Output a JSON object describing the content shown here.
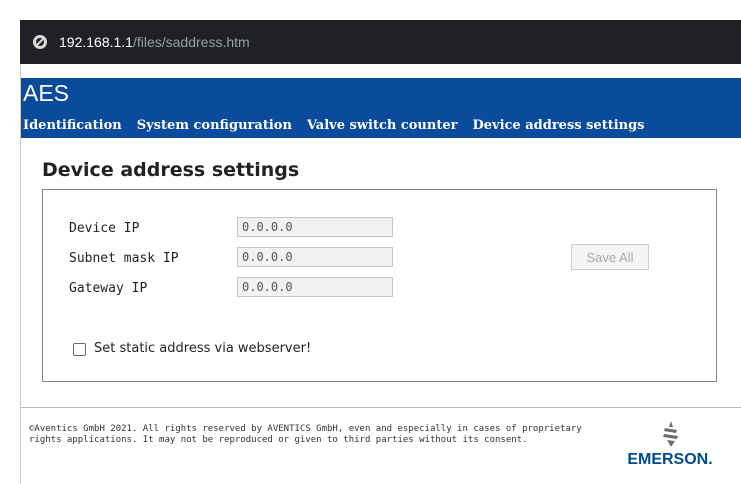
{
  "browser": {
    "url_host": "192.168.1.1",
    "url_path": "/files/saddress.htm"
  },
  "header": {
    "title": "AES",
    "nav": [
      {
        "label": "Identification"
      },
      {
        "label": "System configuration"
      },
      {
        "label": "Valve switch counter"
      },
      {
        "label": "Device address settings"
      }
    ]
  },
  "main": {
    "title": "Device address settings",
    "fields": [
      {
        "label": "Device IP",
        "value": "0.0.0.0"
      },
      {
        "label": "Subnet mask IP",
        "value": "0.0.0.0"
      },
      {
        "label": "Gateway IP",
        "value": "0.0.0.0"
      }
    ],
    "save_label": "Save All",
    "save_enabled": false,
    "static_checkbox": {
      "label": "Set static address via webserver!",
      "checked": false
    }
  },
  "footer": {
    "copyright": "©Aventics GmbH 2021. All rights reserved by AVENTICS GmbH, even and especially in cases of proprietary rights applications. It may not be reproduced or given to third parties without its consent.",
    "logo_text": "EMERSON.",
    "logo_icon": "emerson-logo-icon"
  },
  "colors": {
    "header_bg": "#0a4c9b",
    "browser_bar": "#202124",
    "logo_blue": "#004b8d"
  }
}
